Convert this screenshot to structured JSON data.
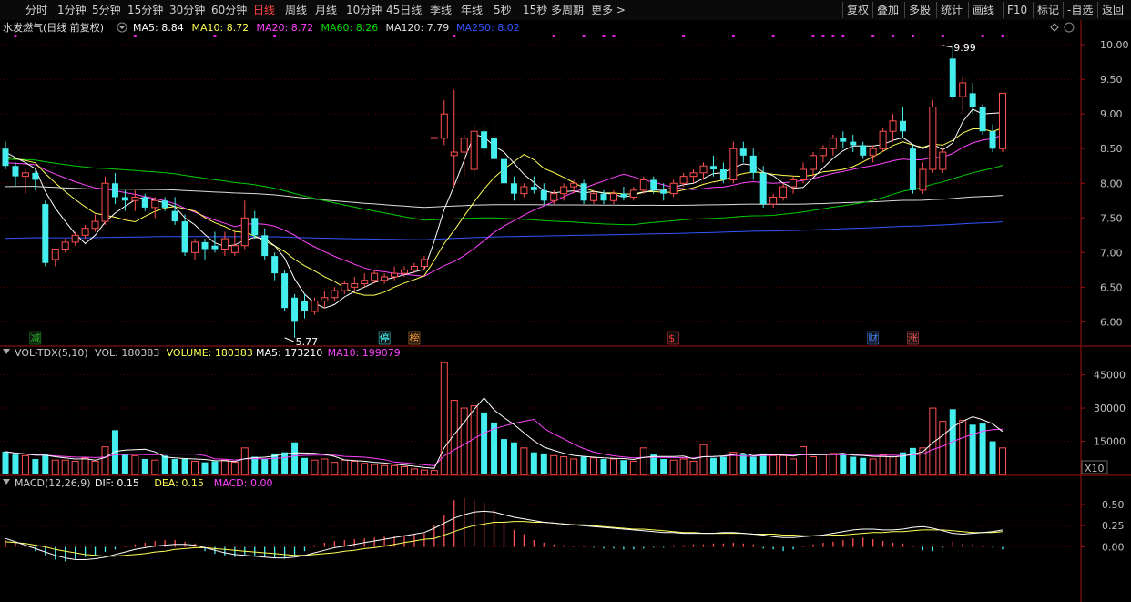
{
  "toolbar": {
    "periods": [
      "分时",
      "1分钟",
      "5分钟",
      "15分钟",
      "30分钟",
      "60分钟",
      "日线",
      "周线",
      "月线",
      "10分钟",
      "45日线",
      "季线",
      "年线",
      "5秒",
      "15秒",
      "多周期",
      "更多 >"
    ],
    "active_period": "日线",
    "right_buttons": [
      "复权",
      "叠加",
      "多股",
      "统计",
      "画线",
      "F10",
      "标记",
      "-自选",
      "返回"
    ]
  },
  "price_panel": {
    "title": "水发燃气(日线 前复权)",
    "ma_labels": [
      {
        "text": "MA5: 8.84",
        "color": "#ffffff"
      },
      {
        "text": "MA10: 8.72",
        "color": "#ffff55"
      },
      {
        "text": "MA20: 8.72",
        "color": "#ff44ff"
      },
      {
        "text": "MA60: 8.26",
        "color": "#00dd00"
      },
      {
        "text": "MA120: 7.79",
        "color": "#dddddd"
      },
      {
        "text": "MA250: 8.02",
        "color": "#3355ff"
      }
    ],
    "markers": [
      {
        "label": "减",
        "color": "#22bb22",
        "index": 3
      },
      {
        "label": "停",
        "color": "#44ffff",
        "index": 38
      },
      {
        "label": "榜",
        "color": "#ff9933",
        "index": 41
      },
      {
        "label": "$",
        "color": "#ff3333",
        "index": 67
      },
      {
        "label": "财",
        "color": "#4488ff",
        "index": 87
      },
      {
        "label": "涨",
        "color": "#ff5555",
        "index": 91
      }
    ]
  },
  "volume_panel": {
    "title": "VOL-TDX(5,10)",
    "labels": [
      {
        "text": "VOL: 180383",
        "color": "#c8c8c8"
      },
      {
        "text": "VOLUME: 180383",
        "color": "#ffff55"
      },
      {
        "text": "MA5: 173210",
        "color": "#ffffff"
      },
      {
        "text": "MA10: 199079",
        "color": "#ff44ff"
      }
    ],
    "unit": "X10"
  },
  "macd_panel": {
    "title": "MACD(12,26,9)",
    "labels": [
      {
        "text": "DIF: 0.15",
        "color": "#ffffff"
      },
      {
        "text": "DEA: 0.15",
        "color": "#ffff55"
      },
      {
        "text": "MACD: 0.00",
        "color": "#ff44ff"
      }
    ]
  },
  "chart_data": {
    "type": "candlestick",
    "title": "水发燃气(日线 前复权)",
    "price_axis": {
      "ticks": [
        6.0,
        6.5,
        7.0,
        7.5,
        8.0,
        8.5,
        9.0,
        9.5,
        10.0
      ],
      "range": [
        5.65,
        10.12
      ]
    },
    "volume_axis": {
      "ticks": [
        15000,
        30000,
        45000
      ],
      "range": [
        0,
        51000
      ]
    },
    "macd_axis": {
      "ticks": [
        0.0,
        0.25,
        0.5
      ],
      "range": [
        -0.65,
        0.65
      ]
    },
    "annotations": [
      {
        "text": "9.99",
        "index": 94,
        "value": 9.99
      },
      {
        "text": "5.77",
        "index": 28,
        "value": 5.77
      }
    ],
    "candles": [
      [
        8.5,
        8.6,
        8.2,
        8.25
      ],
      [
        8.25,
        8.3,
        7.95,
        8.1
      ],
      [
        8.1,
        8.2,
        7.85,
        8.15
      ],
      [
        8.15,
        8.2,
        7.9,
        8.05
      ],
      [
        7.7,
        7.75,
        6.8,
        6.85
      ],
      [
        6.9,
        7.05,
        6.8,
        7.05
      ],
      [
        7.05,
        7.2,
        7.0,
        7.15
      ],
      [
        7.15,
        7.3,
        7.1,
        7.25
      ],
      [
        7.25,
        7.4,
        7.2,
        7.35
      ],
      [
        7.35,
        7.55,
        7.3,
        7.45
      ],
      [
        7.45,
        8.1,
        7.4,
        8.0
      ],
      [
        8.0,
        8.15,
        7.7,
        7.8
      ],
      [
        7.8,
        7.9,
        7.6,
        7.75
      ],
      [
        7.75,
        7.9,
        7.6,
        7.8
      ],
      [
        7.8,
        7.85,
        7.6,
        7.65
      ],
      [
        7.65,
        7.8,
        7.5,
        7.75
      ],
      [
        7.75,
        7.8,
        7.6,
        7.65
      ],
      [
        7.6,
        7.8,
        7.4,
        7.45
      ],
      [
        7.45,
        7.55,
        6.95,
        7.0
      ],
      [
        7.0,
        7.2,
        6.9,
        7.15
      ],
      [
        7.15,
        7.2,
        6.9,
        7.05
      ],
      [
        7.1,
        7.3,
        7.0,
        7.05
      ],
      [
        7.05,
        7.3,
        6.95,
        7.2
      ],
      [
        7.0,
        7.3,
        6.95,
        7.1
      ],
      [
        7.1,
        7.75,
        7.05,
        7.5
      ],
      [
        7.5,
        7.6,
        7.2,
        7.25
      ],
      [
        7.25,
        7.35,
        6.9,
        6.95
      ],
      [
        6.95,
        7.0,
        6.6,
        6.7
      ],
      [
        6.7,
        6.75,
        6.15,
        6.2
      ],
      [
        6.35,
        6.4,
        5.77,
        6.0
      ],
      [
        6.3,
        6.4,
        6.05,
        6.15
      ],
      [
        6.15,
        6.35,
        6.1,
        6.3
      ],
      [
        6.3,
        6.45,
        6.2,
        6.35
      ],
      [
        6.35,
        6.5,
        6.3,
        6.45
      ],
      [
        6.45,
        6.6,
        6.4,
        6.55
      ],
      [
        6.5,
        6.65,
        6.45,
        6.55
      ],
      [
        6.55,
        6.7,
        6.5,
        6.6
      ],
      [
        6.6,
        6.75,
        6.55,
        6.7
      ],
      [
        6.6,
        6.7,
        6.55,
        6.65
      ],
      [
        6.65,
        6.8,
        6.6,
        6.7
      ],
      [
        6.7,
        6.8,
        6.65,
        6.75
      ],
      [
        6.75,
        6.85,
        6.7,
        6.8
      ],
      [
        6.8,
        6.95,
        6.75,
        6.9
      ],
      [
        8.66,
        8.66,
        8.66,
        8.66
      ],
      [
        8.65,
        9.2,
        8.55,
        9.0
      ],
      [
        8.4,
        9.35,
        7.95,
        8.45
      ],
      [
        8.45,
        8.7,
        8.1,
        8.65
      ],
      [
        8.2,
        8.85,
        8.1,
        8.75
      ],
      [
        8.75,
        8.85,
        8.4,
        8.5
      ],
      [
        8.65,
        8.85,
        8.3,
        8.35
      ],
      [
        8.35,
        8.5,
        7.9,
        8.0
      ],
      [
        8.0,
        8.1,
        7.75,
        7.85
      ],
      [
        7.85,
        8.0,
        7.8,
        7.95
      ],
      [
        7.95,
        8.1,
        7.85,
        7.9
      ],
      [
        7.9,
        8.0,
        7.7,
        7.75
      ],
      [
        7.75,
        7.9,
        7.7,
        7.85
      ],
      [
        7.85,
        8.0,
        7.75,
        7.95
      ],
      [
        7.95,
        8.05,
        7.85,
        8.0
      ],
      [
        8.0,
        8.05,
        7.7,
        7.75
      ],
      [
        7.75,
        7.9,
        7.7,
        7.85
      ],
      [
        7.85,
        7.9,
        7.7,
        7.75
      ],
      [
        7.75,
        7.9,
        7.7,
        7.85
      ],
      [
        7.85,
        7.95,
        7.75,
        7.8
      ],
      [
        7.8,
        7.95,
        7.75,
        7.9
      ],
      [
        7.9,
        8.1,
        7.85,
        8.05
      ],
      [
        8.05,
        8.1,
        7.85,
        7.9
      ],
      [
        7.9,
        8.0,
        7.75,
        7.85
      ],
      [
        7.85,
        8.05,
        7.8,
        8.0
      ],
      [
        8.0,
        8.15,
        7.95,
        8.1
      ],
      [
        8.1,
        8.2,
        8.0,
        8.15
      ],
      [
        8.15,
        8.3,
        8.05,
        8.25
      ],
      [
        8.25,
        8.4,
        8.1,
        8.2
      ],
      [
        8.2,
        8.3,
        8.0,
        8.05
      ],
      [
        8.05,
        8.6,
        8.0,
        8.5
      ],
      [
        8.5,
        8.6,
        8.3,
        8.4
      ],
      [
        8.4,
        8.5,
        8.05,
        8.15
      ],
      [
        8.15,
        8.25,
        7.65,
        7.7
      ],
      [
        7.7,
        7.85,
        7.65,
        7.8
      ],
      [
        7.8,
        8.0,
        7.75,
        7.95
      ],
      [
        7.95,
        8.1,
        7.85,
        8.05
      ],
      [
        8.05,
        8.3,
        8.0,
        8.2
      ],
      [
        8.2,
        8.45,
        8.1,
        8.4
      ],
      [
        8.4,
        8.55,
        8.3,
        8.5
      ],
      [
        8.5,
        8.7,
        8.4,
        8.65
      ],
      [
        8.65,
        8.75,
        8.5,
        8.6
      ],
      [
        8.6,
        8.7,
        8.45,
        8.55
      ],
      [
        8.55,
        8.6,
        8.35,
        8.4
      ],
      [
        8.4,
        8.55,
        8.3,
        8.5
      ],
      [
        8.5,
        8.8,
        8.45,
        8.75
      ],
      [
        8.75,
        9.0,
        8.6,
        8.9
      ],
      [
        8.9,
        9.1,
        8.65,
        8.75
      ],
      [
        8.5,
        8.55,
        7.85,
        7.9
      ],
      [
        7.9,
        8.3,
        7.85,
        8.2
      ],
      [
        8.2,
        9.2,
        8.15,
        9.1
      ],
      [
        8.2,
        8.5,
        8.15,
        8.45
      ],
      [
        9.8,
        9.99,
        9.2,
        9.25
      ],
      [
        9.25,
        9.55,
        9.05,
        9.45
      ],
      [
        9.3,
        9.45,
        9.0,
        9.1
      ],
      [
        9.1,
        9.15,
        8.7,
        8.75
      ],
      [
        8.75,
        8.85,
        8.45,
        8.5
      ],
      [
        8.5,
        9.3,
        8.45,
        9.3
      ]
    ],
    "volume": [
      10300,
      9000,
      8500,
      7000,
      9000,
      6500,
      6500,
      6000,
      7500,
      6000,
      12500,
      20000,
      9000,
      8500,
      7000,
      6500,
      8500,
      7000,
      7000,
      6000,
      5500,
      6000,
      6500,
      5500,
      12000,
      8000,
      7000,
      9500,
      10000,
      14500,
      7500,
      6500,
      7000,
      5500,
      6500,
      6000,
      5000,
      4500,
      4000,
      4000,
      3500,
      2500,
      2000,
      1800,
      50500,
      33500,
      30000,
      31000,
      28000,
      23500,
      16000,
      14500,
      12000,
      10000,
      9500,
      8500,
      8000,
      7000,
      8000,
      7500,
      7000,
      7000,
      6500,
      6000,
      12000,
      9000,
      7000,
      6500,
      7000,
      6000,
      13500,
      7500,
      8000,
      10000,
      9000,
      8000,
      9500,
      8500,
      8500,
      7000,
      12500,
      8000,
      9000,
      9500,
      9000,
      8000,
      7500,
      7000,
      9000,
      8000,
      10000,
      12000,
      12000,
      30000,
      24000,
      29500,
      24500,
      22500,
      23000,
      15000,
      12000,
      45500,
      23500,
      16000,
      16000,
      17000,
      16500,
      18000
    ],
    "macd": [
      0.08,
      0.05,
      0.02,
      -0.05,
      -0.1,
      -0.15,
      -0.17,
      -0.15,
      -0.12,
      -0.1,
      -0.06,
      -0.03,
      0.01,
      0.03,
      0.05,
      0.07,
      0.08,
      0.08,
      0.06,
      0.04,
      -0.05,
      -0.08,
      -0.1,
      -0.12,
      -0.09,
      -0.1,
      -0.12,
      -0.13,
      -0.14,
      -0.1,
      -0.05,
      0.02,
      0.05,
      0.07,
      0.08,
      0.09,
      0.1,
      0.11,
      0.12,
      0.13,
      0.14,
      0.15,
      0.16,
      0.25,
      0.38,
      0.55,
      0.58,
      0.55,
      0.52,
      0.45,
      0.3,
      0.2,
      0.15,
      0.08,
      0.05,
      0.03,
      0.02,
      0.01,
      0.01,
      -0.01,
      -0.02,
      -0.02,
      -0.03,
      -0.03,
      -0.02,
      -0.01,
      -0.01,
      0.02,
      0.02,
      0.03,
      0.03,
      0.04,
      0.04,
      0.05,
      0.04,
      0.03,
      -0.02,
      -0.03,
      -0.05,
      -0.03,
      0.01,
      0.03,
      0.05,
      0.06,
      0.08,
      0.1,
      0.11,
      0.09,
      0.07,
      0.05,
      0.04,
      0.01,
      -0.04,
      -0.05,
      -0.01,
      0.06,
      0.04,
      0.03,
      0.02,
      -0.01,
      -0.03,
      -0.04,
      0.0,
      0.0,
      0.0,
      0.0,
      0.0,
      0.0
    ],
    "dif": [
      0.1,
      0.06,
      0.02,
      -0.02,
      -0.06,
      -0.1,
      -0.13,
      -0.15,
      -0.15,
      -0.14,
      -0.12,
      -0.09,
      -0.06,
      -0.03,
      -0.01,
      0.01,
      0.02,
      0.03,
      0.03,
      0.02,
      -0.01,
      -0.04,
      -0.07,
      -0.09,
      -0.1,
      -0.11,
      -0.12,
      -0.13,
      -0.13,
      -0.12,
      -0.1,
      -0.07,
      -0.04,
      -0.01,
      0.01,
      0.03,
      0.05,
      0.07,
      0.09,
      0.11,
      0.13,
      0.15,
      0.17,
      0.22,
      0.28,
      0.34,
      0.38,
      0.41,
      0.42,
      0.41,
      0.38,
      0.35,
      0.33,
      0.31,
      0.29,
      0.28,
      0.27,
      0.26,
      0.25,
      0.24,
      0.23,
      0.22,
      0.21,
      0.2,
      0.19,
      0.18,
      0.17,
      0.17,
      0.16,
      0.16,
      0.16,
      0.16,
      0.17,
      0.17,
      0.16,
      0.15,
      0.14,
      0.12,
      0.11,
      0.11,
      0.12,
      0.13,
      0.14,
      0.16,
      0.18,
      0.2,
      0.21,
      0.21,
      0.2,
      0.2,
      0.21,
      0.23,
      0.24,
      0.22,
      0.19,
      0.16,
      0.15,
      0.16,
      0.17,
      0.18,
      0.2,
      0.19,
      0.17,
      0.16,
      0.16,
      0.15,
      0.15,
      0.15
    ],
    "dea": [
      0.06,
      0.05,
      0.04,
      0.02,
      0.0,
      -0.03,
      -0.05,
      -0.07,
      -0.09,
      -0.1,
      -0.11,
      -0.11,
      -0.1,
      -0.09,
      -0.08,
      -0.06,
      -0.05,
      -0.03,
      -0.02,
      -0.01,
      -0.01,
      -0.02,
      -0.03,
      -0.04,
      -0.05,
      -0.06,
      -0.07,
      -0.08,
      -0.09,
      -0.1,
      -0.1,
      -0.09,
      -0.08,
      -0.07,
      -0.05,
      -0.04,
      -0.02,
      -0.01,
      0.01,
      0.03,
      0.05,
      0.07,
      0.09,
      0.1,
      0.14,
      0.18,
      0.22,
      0.25,
      0.27,
      0.29,
      0.29,
      0.3,
      0.3,
      0.29,
      0.29,
      0.28,
      0.27,
      0.26,
      0.26,
      0.25,
      0.24,
      0.23,
      0.22,
      0.21,
      0.21,
      0.2,
      0.19,
      0.18,
      0.17,
      0.17,
      0.16,
      0.16,
      0.16,
      0.16,
      0.16,
      0.15,
      0.15,
      0.15,
      0.14,
      0.14,
      0.13,
      0.13,
      0.13,
      0.14,
      0.14,
      0.15,
      0.16,
      0.17,
      0.17,
      0.18,
      0.18,
      0.19,
      0.2,
      0.2,
      0.2,
      0.19,
      0.18,
      0.17,
      0.17,
      0.17,
      0.18,
      0.18,
      0.17,
      0.16,
      0.16,
      0.15,
      0.15,
      0.15
    ]
  }
}
